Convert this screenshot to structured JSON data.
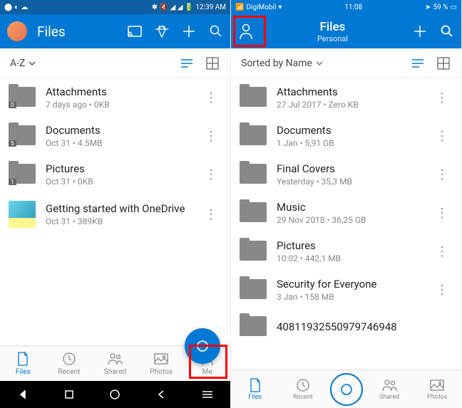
{
  "left": {
    "status": {
      "time": "12:39 AM"
    },
    "header": {
      "title": "Files"
    },
    "sort": {
      "label": "A-Z"
    },
    "items": [
      {
        "name": "Attachments",
        "meta": "7 days ago • 0KB",
        "badge": "0"
      },
      {
        "name": "Documents",
        "meta": "Oct 31 • 4.5MB",
        "badge": "5"
      },
      {
        "name": "Pictures",
        "meta": "Oct 31 • 0KB",
        "badge": "1"
      },
      {
        "name": "Getting started with OneDrive",
        "meta": "Oct 31 • 389KB",
        "thumb": true
      }
    ],
    "tabs": [
      {
        "label": "Files",
        "active": true
      },
      {
        "label": "Recent"
      },
      {
        "label": "Shared"
      },
      {
        "label": "Photos"
      },
      {
        "label": "Me"
      }
    ]
  },
  "right": {
    "status": {
      "carrier": "DigiMobil",
      "time": "11:08",
      "battery": "59 %"
    },
    "header": {
      "title": "Files",
      "subtitle": "Personal"
    },
    "sort": {
      "label": "Sorted by Name"
    },
    "items": [
      {
        "name": "Attachments",
        "meta": "27 Jul 2017 • Zero KB"
      },
      {
        "name": "Documents",
        "meta": "1 Jan • 5,91 GB"
      },
      {
        "name": "Final Covers",
        "meta": "Yesterday • 35,3 MB"
      },
      {
        "name": "Music",
        "meta": "29 Nov 2018 • 36,25 GB"
      },
      {
        "name": "Pictures",
        "meta": "10:02 • 442,1 MB"
      },
      {
        "name": "Security for Everyone",
        "meta": "3 Jan • 158 MB"
      },
      {
        "name": "40811932550979746948",
        "meta": ""
      }
    ],
    "tabs": [
      {
        "label": "Files",
        "active": true
      },
      {
        "label": "Recent"
      },
      {
        "label": "Shared"
      },
      {
        "label": "Photos"
      }
    ]
  }
}
